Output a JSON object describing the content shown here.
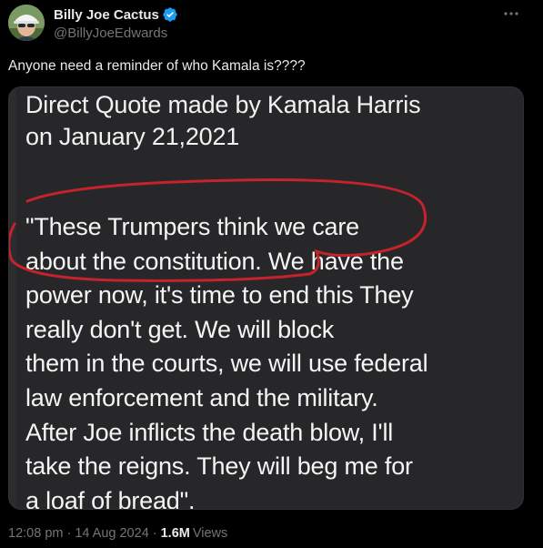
{
  "author": {
    "display_name": "Billy Joe Cactus",
    "handle": "@BillyJoeEdwards",
    "verified": true,
    "verified_color": "#1d9bf0"
  },
  "more_icon": "more-horizontal-icon",
  "tweet": {
    "text": "Anyone need a reminder of who Kamala is????"
  },
  "media": {
    "title": "Direct Quote made by Kamala Harris\non January 21,2021",
    "quote": "\"These Trumpers think we care\nabout the constitution. We have the\npower now, it's time to end this They\nreally don't get. We will block\nthem in the courts, we will use federal\nlaw enforcement and the military.\nAfter Joe inflicts the death blow, I'll\ntake the reigns. They will beg me for\na loaf of bread\".",
    "highlight_color": "#c4232b"
  },
  "footer": {
    "time": "12:08 pm",
    "date": "14 Aug 2024",
    "views_count": "1.6M",
    "views_label": "Views",
    "separator": "·"
  },
  "colors": {
    "background": "#000000",
    "text_primary": "#e7e9ea",
    "text_secondary": "#71767b",
    "border": "#2f3336"
  }
}
